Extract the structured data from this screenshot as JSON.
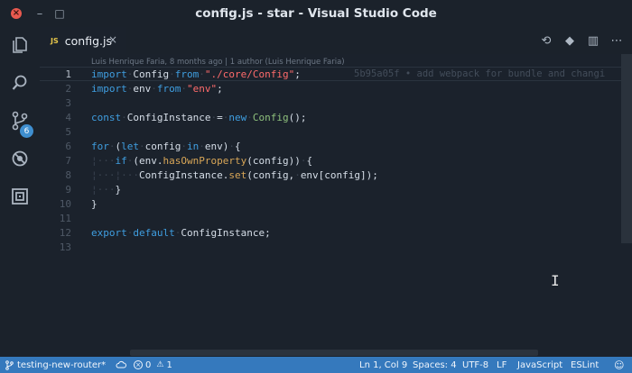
{
  "window": {
    "title": "config.js - star - Visual Studio Code",
    "close_glyph": "×",
    "minimize_glyph": "–",
    "maximize_glyph": "□"
  },
  "activity_bar": {
    "items": [
      {
        "name": "explorer",
        "icon": "files-icon"
      },
      {
        "name": "search",
        "icon": "search-icon"
      },
      {
        "name": "source-control",
        "icon": "git-branch-icon",
        "badge": "6"
      },
      {
        "name": "debug",
        "icon": "debug-icon"
      },
      {
        "name": "extensions",
        "icon": "extensions-icon"
      }
    ]
  },
  "tabs": [
    {
      "label": "config.js",
      "type_badge": "JS",
      "close": "×",
      "active": true
    }
  ],
  "tab_actions": [
    "open-changes-icon",
    "git-commit-icon",
    "split-editor-icon",
    "more-icon"
  ],
  "tab_action_glyphs": [
    "⟲",
    "◆",
    "▥",
    "⋯"
  ],
  "editor": {
    "codelens": "Luis Henrique Faria, 8 months ago | 1 author (Luis Henrique Faria)",
    "blame": "5b95a05f • add webpack for bundle and changi",
    "active_line": 1,
    "line_numbers": [
      "1",
      "2",
      "3",
      "4",
      "5",
      "6",
      "7",
      "8",
      "9",
      "10",
      "11",
      "12",
      "13"
    ],
    "lines": [
      [
        {
          "t": "import",
          "c": "kw"
        },
        {
          "t": "·",
          "c": "ws"
        },
        {
          "t": "Config"
        },
        {
          "t": "·",
          "c": "ws"
        },
        {
          "t": "from",
          "c": "kw"
        },
        {
          "t": "·",
          "c": "ws"
        },
        {
          "t": "\"./core/Config\"",
          "c": "str"
        },
        {
          "t": ";"
        }
      ],
      [
        {
          "t": "import",
          "c": "kw"
        },
        {
          "t": "·",
          "c": "ws"
        },
        {
          "t": "env"
        },
        {
          "t": "·",
          "c": "ws"
        },
        {
          "t": "from",
          "c": "kw"
        },
        {
          "t": "·",
          "c": "ws"
        },
        {
          "t": "\"env\"",
          "c": "str"
        },
        {
          "t": ";"
        }
      ],
      [],
      [
        {
          "t": "const",
          "c": "kw"
        },
        {
          "t": "·",
          "c": "ws"
        },
        {
          "t": "ConfigInstance"
        },
        {
          "t": "·",
          "c": "ws"
        },
        {
          "t": "="
        },
        {
          "t": "·",
          "c": "ws"
        },
        {
          "t": "new",
          "c": "kw"
        },
        {
          "t": "·",
          "c": "ws"
        },
        {
          "t": "Config",
          "c": "cls"
        },
        {
          "t": "();"
        }
      ],
      [],
      [
        {
          "t": "for",
          "c": "kw"
        },
        {
          "t": "·",
          "c": "ws"
        },
        {
          "t": "("
        },
        {
          "t": "let",
          "c": "kw"
        },
        {
          "t": "·",
          "c": "ws"
        },
        {
          "t": "config"
        },
        {
          "t": "·",
          "c": "ws"
        },
        {
          "t": "in",
          "c": "kw"
        },
        {
          "t": "·",
          "c": "ws"
        },
        {
          "t": "env)"
        },
        {
          "t": "·",
          "c": "ws"
        },
        {
          "t": "{"
        }
      ],
      [
        {
          "t": "¦···",
          "c": "ws"
        },
        {
          "t": "if",
          "c": "kw"
        },
        {
          "t": "·",
          "c": "ws"
        },
        {
          "t": "(env."
        },
        {
          "t": "hasOwnProperty",
          "c": "fn"
        },
        {
          "t": "(config))"
        },
        {
          "t": "·",
          "c": "ws"
        },
        {
          "t": "{"
        }
      ],
      [
        {
          "t": "¦···¦···",
          "c": "ws"
        },
        {
          "t": "ConfigInstance."
        },
        {
          "t": "set",
          "c": "fn"
        },
        {
          "t": "(config,"
        },
        {
          "t": "·",
          "c": "ws"
        },
        {
          "t": "env[config]);"
        }
      ],
      [
        {
          "t": "¦···",
          "c": "ws"
        },
        {
          "t": "}"
        }
      ],
      [
        {
          "t": "}"
        }
      ],
      [],
      [
        {
          "t": "export",
          "c": "kw"
        },
        {
          "t": "·",
          "c": "ws"
        },
        {
          "t": "default",
          "c": "kw"
        },
        {
          "t": "·",
          "c": "ws"
        },
        {
          "t": "ConfigInstance;"
        }
      ],
      []
    ]
  },
  "status_bar": {
    "branch": "testing-new-router*",
    "errors": "0",
    "warnings": "1",
    "position": "Ln 1, Col 9",
    "spaces": "Spaces: 4",
    "encoding": "UTF-8",
    "eol": "LF",
    "language": "JavaScript",
    "linter": "ESLint"
  },
  "colors": {
    "background": "#1b222c",
    "status_bar": "#3579bd",
    "keyword": "#3f9ee0",
    "string": "#ff6b6b",
    "class": "#8ec07c",
    "function": "#d8a657"
  }
}
